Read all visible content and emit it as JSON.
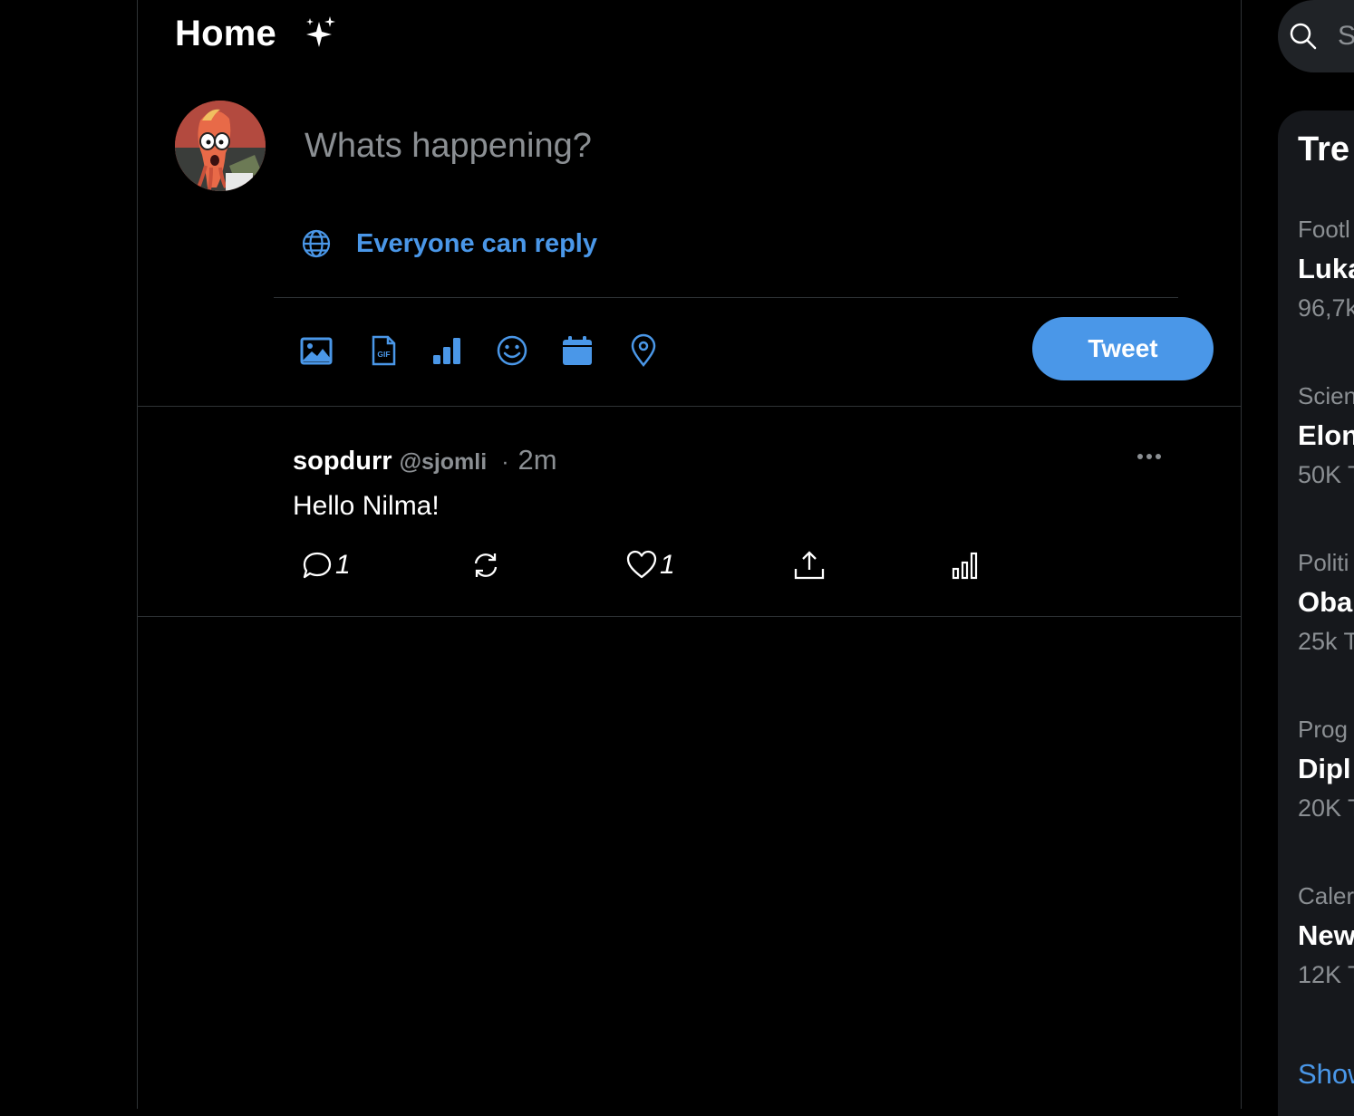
{
  "header": {
    "title": "Home",
    "sparkle_icon": "sparkle-icon"
  },
  "compose": {
    "placeholder": "Whats happening?",
    "reply_setting": "Everyone can reply",
    "tools": [
      "image-icon",
      "gif-icon",
      "poll-icon",
      "emoji-icon",
      "schedule-icon",
      "location-icon"
    ],
    "tweet_button": "Tweet"
  },
  "tweet": {
    "name": "sopdurr",
    "handle": "@sjomli",
    "dot": "·",
    "time": "2m",
    "text": "Hello Nilma!",
    "reply_count": "1",
    "like_count": "1"
  },
  "sidebar": {
    "search_placeholder": "Se",
    "trends_title": "Tre",
    "trends": [
      {
        "category": "Footl",
        "name": "Luka",
        "count": "96,7k"
      },
      {
        "category": "Scien",
        "name": "Elon",
        "count": "50K T"
      },
      {
        "category": "Politi",
        "name": "Oba",
        "count": "25k T"
      },
      {
        "category": "Prog",
        "name": "Dipl",
        "count": "20K T"
      },
      {
        "category": "Caler",
        "name": "New",
        "count": "12K T"
      }
    ],
    "show_more": "Show"
  },
  "colors": {
    "accent": "#4a97e8",
    "background": "#000000",
    "muted": "#8b8f93",
    "border": "#2f3336"
  }
}
